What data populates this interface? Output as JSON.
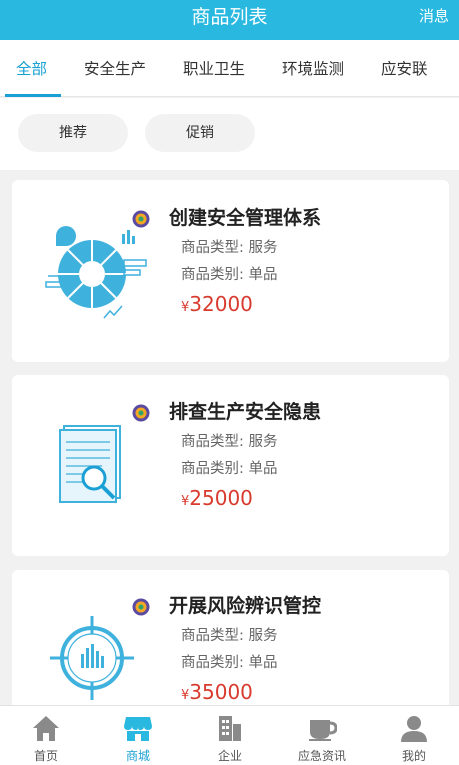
{
  "header": {
    "title": "商品列表",
    "message_label": "消息"
  },
  "tabs": [
    "全部",
    "安全生产",
    "职业卫生",
    "环境监测",
    "应安联"
  ],
  "filters": [
    "推荐",
    "促销"
  ],
  "products": [
    {
      "title": "创建安全管理体系",
      "type_label": "商品类型: 服务",
      "category_label": "商品类别: 单品",
      "currency": "¥",
      "price": "32000",
      "image_icon": "pie-chart-infographic-icon"
    },
    {
      "title": "排查生产安全隐患",
      "type_label": "商品类型: 服务",
      "category_label": "商品类别: 单品",
      "currency": "¥",
      "price": "25000",
      "image_icon": "document-magnifier-icon"
    },
    {
      "title": "开展风险辨识管控",
      "type_label": "商品类型: 服务",
      "category_label": "商品类别: 单品",
      "currency": "¥",
      "price": "35000",
      "image_icon": "crosshair-bar-chart-icon"
    }
  ],
  "bottom_nav": [
    {
      "label": "首页",
      "icon": "home-icon"
    },
    {
      "label": "商城",
      "icon": "store-icon"
    },
    {
      "label": "企业",
      "icon": "building-icon"
    },
    {
      "label": "应急资讯",
      "icon": "cup-icon"
    },
    {
      "label": "我的",
      "icon": "user-icon"
    }
  ],
  "colors": {
    "accent": "#29b8df",
    "active": "#1aa0d4",
    "price": "#d83a2e",
    "icon_gray": "#8a8a8a"
  }
}
